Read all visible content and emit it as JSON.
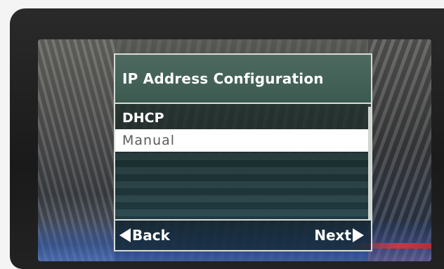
{
  "dialog": {
    "title": "IP Address Configuration",
    "options": [
      {
        "label": "DHCP",
        "state": "default"
      },
      {
        "label": "Manual",
        "state": "selected"
      }
    ]
  },
  "softkeys": {
    "back_label": "Back",
    "next_label": "Next",
    "back_icon": "triangle-left-icon",
    "next_icon": "triangle-right-icon"
  },
  "colors": {
    "title_bar": "#3b5a50",
    "selected_row": "#ffffff",
    "border": "#d8dcd6",
    "text": "#ffffff"
  }
}
